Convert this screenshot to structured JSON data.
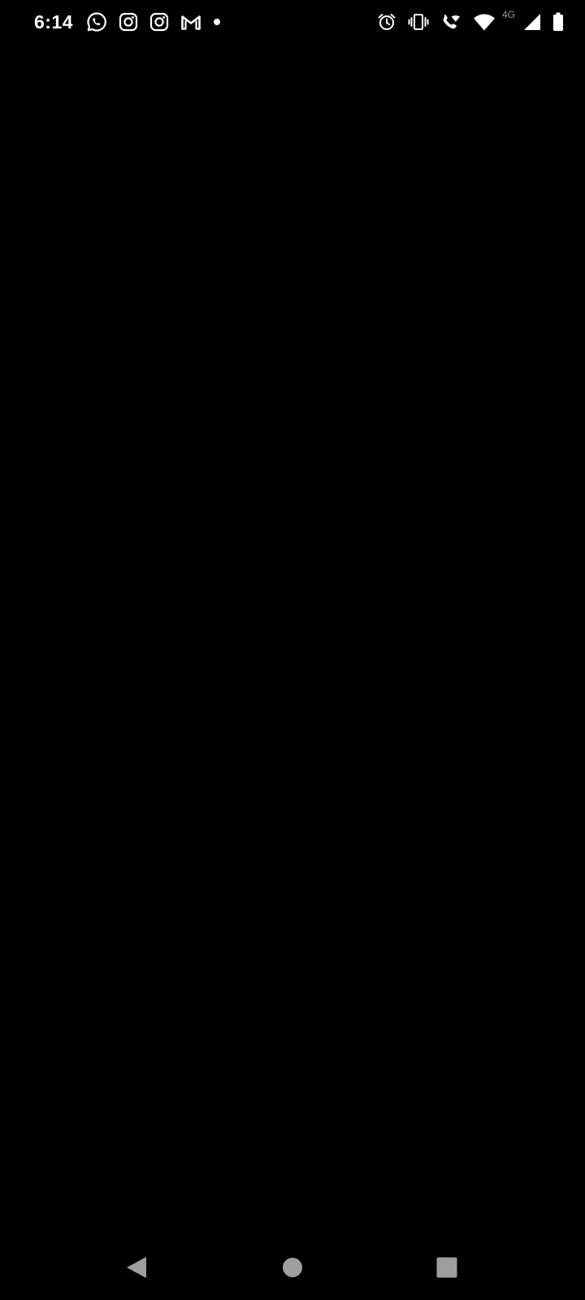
{
  "status_bar": {
    "time": "6:14",
    "network_type": "4G",
    "notification_icons": [
      "whatsapp-icon",
      "instagram-icon",
      "instagram-icon",
      "gmail-icon",
      "dot-icon"
    ],
    "system_icons": [
      "alarm-icon",
      "vibrate-icon",
      "wifi-call-icon",
      "wifi-icon",
      "cell-signal-icon",
      "battery-icon"
    ]
  },
  "nav_bar": {
    "buttons": [
      "back-icon",
      "home-icon",
      "recents-icon"
    ]
  },
  "colors": {
    "background": "#000000",
    "status_text": "#ffffff",
    "nav_buttons": "#9e9e9e",
    "network_label": "#9e9e9e"
  }
}
